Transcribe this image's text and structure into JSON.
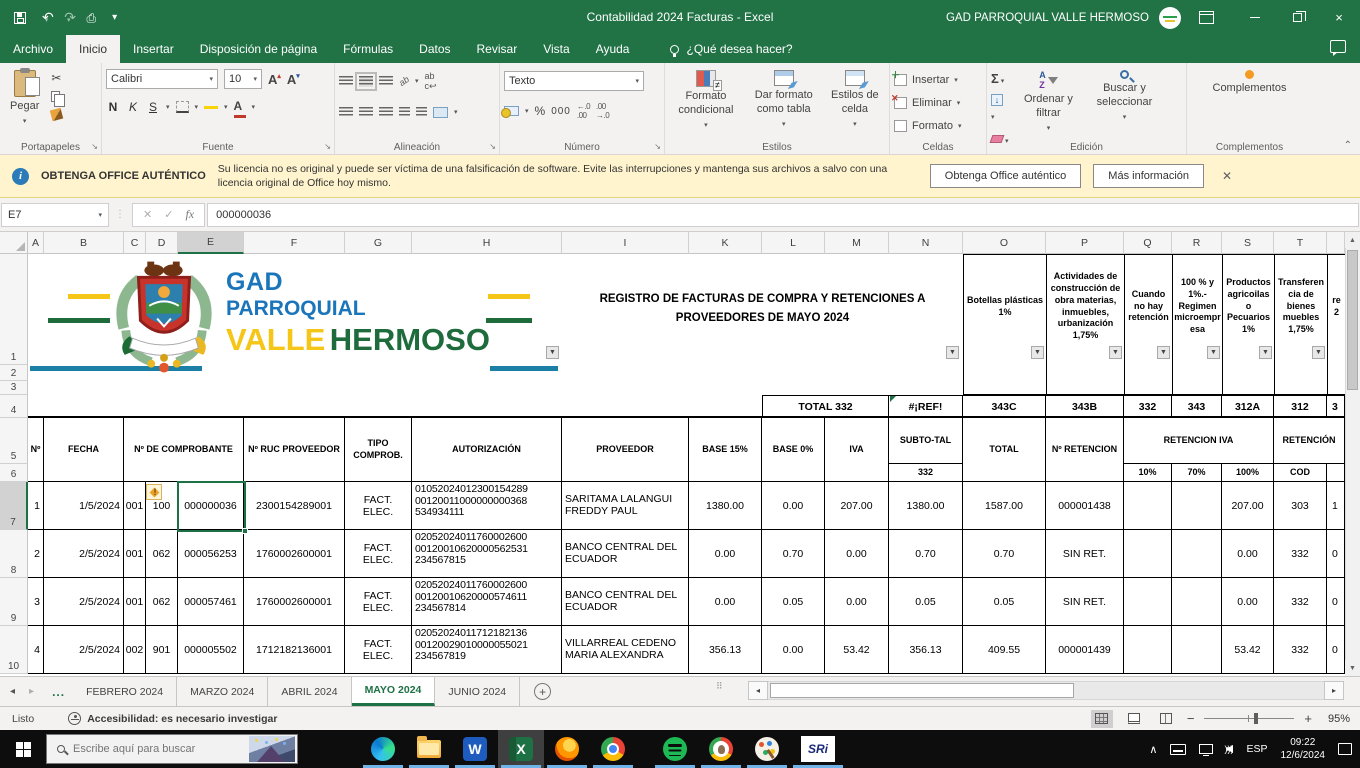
{
  "colors": {
    "excel_green": "#217346",
    "selection_green": "#1e7145",
    "warning_bg": "#fff4ce",
    "taskbar_underline": "#6fb3e8"
  },
  "titlebar": {
    "title": "Contabilidad 2024 Facturas  -  Excel",
    "account": "GAD PARROQUIAL VALLE HERMOSO"
  },
  "menubar": {
    "tabs": [
      "Archivo",
      "Inicio",
      "Insertar",
      "Disposición de página",
      "Fórmulas",
      "Datos",
      "Revisar",
      "Vista",
      "Ayuda"
    ],
    "active_tab": "Inicio",
    "tell_me": "¿Qué desea hacer?"
  },
  "ribbon": {
    "paste": "Pegar",
    "clipboard_group": "Portapapeles",
    "font_name": "Calibri",
    "font_size": "10",
    "bold": "N",
    "italic": "K",
    "underline": "S",
    "font_group": "Fuente",
    "alignment_group": "Alineación",
    "number_format": "Texto",
    "percent": "%",
    "thousands": "000",
    "number_group": "Número",
    "conditional": "Formato condicional",
    "format_table": "Dar formato como tabla",
    "cell_styles": "Estilos de celda",
    "styles_group": "Estilos",
    "insert": "Insertar",
    "delete": "Eliminar",
    "format": "Formato",
    "cells_group": "Celdas",
    "sort_filter": "Ordenar y filtrar",
    "find_select": "Buscar y seleccionar",
    "editing_group": "Edición",
    "addins_button": "Complementos",
    "addins_group": "Complementos"
  },
  "warning": {
    "title": "OBTENGA OFFICE AUTÉNTICO",
    "message": "Su licencia no es original y puede ser víctima de una falsificación de software. Evite las interrupciones y mantenga sus archivos a salvo con una licencia original de Office hoy mismo.",
    "get_office": "Obtenga Office auténtico",
    "more_info": "Más información"
  },
  "formula_bar": {
    "name_box": "E7",
    "fx": "fx",
    "value": "000000036"
  },
  "sheet": {
    "columns": [
      "A",
      "B",
      "C",
      "D",
      "E",
      "F",
      "G",
      "H",
      "I",
      "K",
      "L",
      "M",
      "N",
      "O",
      "P",
      "Q",
      "R",
      "S",
      "T"
    ],
    "selected_column": "E",
    "selected_row": "7",
    "row_numbers": [
      "1",
      "2",
      "3",
      "4",
      "5",
      "6",
      "7",
      "8",
      "9",
      "10"
    ],
    "logo": {
      "gad": "GAD",
      "parroquial": "PARROQUIAL",
      "valle": "VALLE",
      "hermoso": "HERMOSO"
    },
    "title": "REGISTRO DE FACTURAS DE COMPRA Y RETENCIONES A PROVEEDORES DE MAYO 2024",
    "filter_headers": {
      "O": "Botellas plásticas 1%",
      "P": "Actividades de construcción de obra materias, inmuebles, urbanización 1,75%",
      "Q": "Cuando no hay retención",
      "R": "100 % y 1%.- Regimen microempresa",
      "S": "Productos agricoilas o Pecuarios 1%",
      "T": "Transferencia de bienes muebles 1,75%",
      "U_partial": "re 2"
    },
    "row4": {
      "LM": "TOTAL 332",
      "N": "#¡REF!",
      "O": "343C",
      "P": "343B",
      "Q": "332",
      "R": "343",
      "S": "312A",
      "T": "312",
      "U": "3"
    },
    "table_headers": {
      "A": "Nº",
      "B": "FECHA",
      "CDE": "Nº DE COMPROBANTE",
      "F": "Nº RUC PROVEEDOR",
      "G": "TIPO COMPROB.",
      "H": "AUTORIZACIÓN",
      "I": "PROVEEDOR",
      "K": "BASE 15%",
      "L": "BASE 0%",
      "M": "IVA",
      "N5": "SUBTO-TAL",
      "N6": "332",
      "O": "TOTAL",
      "P": "Nº RETENCION",
      "QRS": "RETENCION IVA",
      "Q6": "10%",
      "R6": "70%",
      "S6": "100%",
      "TU": "RETENCIÓN",
      "T6": "COD"
    },
    "data_rows": [
      [
        "1",
        "1/5/2024",
        "001",
        "100",
        "000000036",
        "2300154289001",
        "FACT. ELEC.",
        "01052024012300154289 00120011000000000368 534934111",
        "SARITAMA LALANGUI FREDDY PAUL",
        "1380.00",
        "0.00",
        "207.00",
        "1380.00",
        "1587.00",
        "000001438",
        "",
        "",
        "207.00",
        "303",
        "1"
      ],
      [
        "2",
        "2/5/2024",
        "001",
        "062",
        "000056253",
        "1760002600001",
        "FACT. ELEC.",
        "02052024011760002600 00120010620000562531 234567815",
        "BANCO CENTRAL DEL ECUADOR",
        "0.00",
        "0.70",
        "0.00",
        "0.70",
        "0.70",
        "SIN RET.",
        "",
        "",
        "0.00",
        "332",
        "0"
      ],
      [
        "3",
        "2/5/2024",
        "001",
        "062",
        "000057461",
        "1760002600001",
        "FACT. ELEC.",
        "02052024011760002600 00120010620000574611 234567814",
        "BANCO CENTRAL DEL ECUADOR",
        "0.00",
        "0.05",
        "0.00",
        "0.05",
        "0.05",
        "SIN RET.",
        "",
        "",
        "0.00",
        "332",
        "0"
      ],
      [
        "4",
        "2/5/2024",
        "002",
        "901",
        "000005502",
        "1712182136001",
        "FACT. ELEC.",
        "02052024011712182136 00120029010000055021 234567819",
        "VILLARREAL CEDENO MARIA ALEXANDRA",
        "356.13",
        "0.00",
        "53.42",
        "356.13",
        "409.55",
        "000001439",
        "",
        "",
        "53.42",
        "332",
        "0"
      ]
    ]
  },
  "sheet_tabs": {
    "tabs": [
      "FEBRERO 2024",
      "MARZO 2024",
      "ABRIL 2024",
      "MAYO 2024",
      "JUNIO 2024"
    ],
    "active": "MAYO 2024"
  },
  "status_bar": {
    "mode": "Listo",
    "accessibility": "Accesibilidad: es necesario investigar",
    "zoom_level": "95%"
  },
  "taskbar": {
    "search_placeholder": "Escribe aquí para buscar",
    "language": "ESP",
    "time": "09:22",
    "date": "12/6/2024",
    "sri_label": "SRi"
  }
}
